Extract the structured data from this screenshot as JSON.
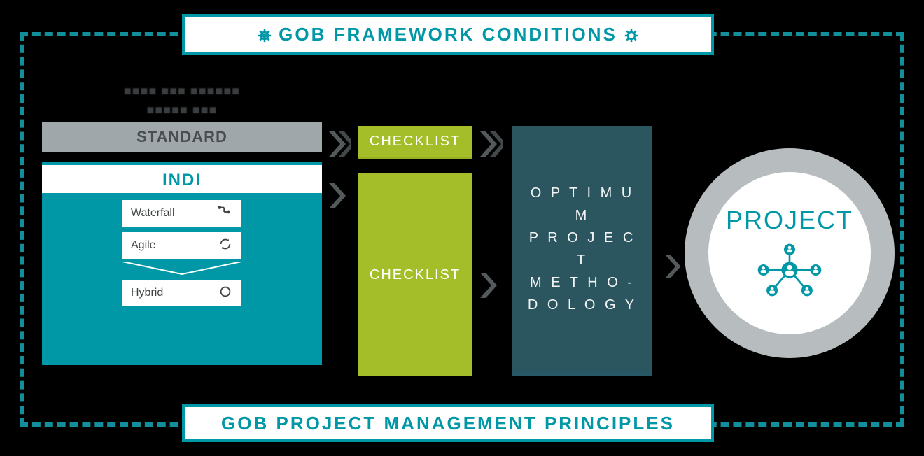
{
  "colors": {
    "teal": "#0097a7",
    "olive": "#a4be2a",
    "dark_teal": "#2b5660",
    "gray": "#a0a7ab"
  },
  "frame": {
    "top_title": "GOB FRAMEWORK CONDITIONS",
    "bottom_title": "GOB PROJECT MANAGEMENT PRINCIPLES"
  },
  "left": {
    "obscured_line1": "■■■■  ■■■ ■■■■■■",
    "obscured_line2": "■■■■■ ■■■",
    "standard_label": "STANDARD",
    "indi_label": "INDI",
    "methods": [
      {
        "label": "Waterfall",
        "icon": "waterfall-icon"
      },
      {
        "label": "Agile",
        "icon": "agile-icon"
      },
      {
        "label": "Hybrid",
        "icon": "hybrid-icon"
      }
    ]
  },
  "checklists": {
    "top": "CHECKLIST",
    "big": "CHECKLIST"
  },
  "optimum": {
    "text": "O P T I M U M\nP R O J E C T\nM E T H O -\nD O L O G Y"
  },
  "project": {
    "label": "PROJECT"
  }
}
